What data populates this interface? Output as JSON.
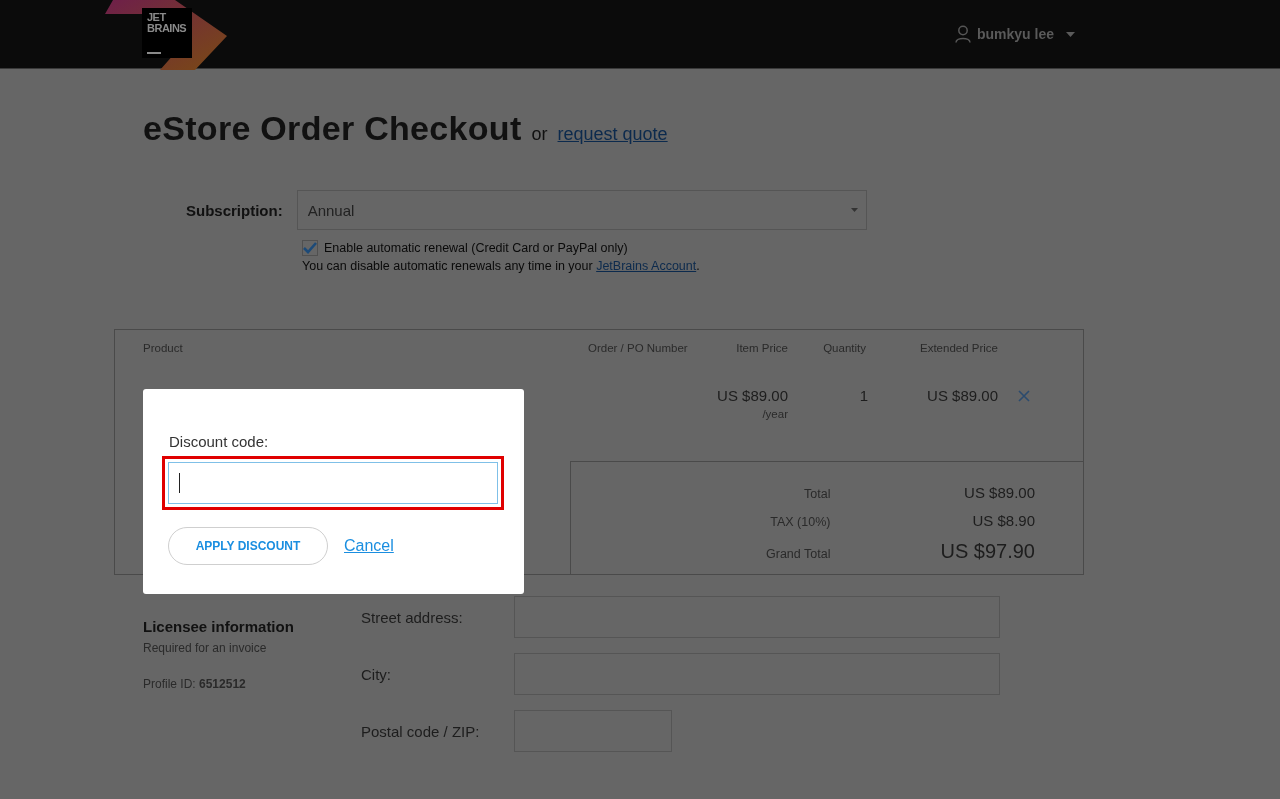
{
  "header": {
    "logo": [
      "JET",
      "BRAINS"
    ],
    "user": "bumkyu lee"
  },
  "title": "eStore Order Checkout",
  "title_or": "or",
  "request_quote": "request quote",
  "subscription": {
    "label": "Subscription:",
    "value": "Annual"
  },
  "renewal": {
    "label": "Enable automatic renewal (Credit Card or PayPal only)",
    "checked": true,
    "note": "You can disable automatic renewals any time in your ",
    "link": "JetBrains Account",
    "note_end": "."
  },
  "table": {
    "columns": [
      "Product",
      "Order / PO Number",
      "Item Price",
      "Quantity",
      "Extended Price"
    ],
    "rows": [
      {
        "item_price": "US $89.00",
        "period": "/year",
        "quantity": "1",
        "extended_price": "US $89.00"
      }
    ],
    "totals": [
      {
        "label": "Total",
        "value": "US $89.00",
        "kind": "normal"
      },
      {
        "label": "TAX (10%)",
        "value": "US $8.90",
        "kind": "normal"
      },
      {
        "label": "Grand Total",
        "value": "US $97.90",
        "kind": "grand"
      }
    ]
  },
  "licensee": {
    "heading": "Licensee information",
    "sub": "Required for an invoice",
    "profile": "Profile ID: **6512512**",
    "fields": [
      {
        "label": "Street address:",
        "kind": "wide"
      },
      {
        "label": "City:",
        "kind": "wide"
      },
      {
        "label": "Postal code / ZIP:",
        "kind": "short"
      }
    ]
  },
  "dialog": {
    "label": "Discount code:",
    "highlighted": true,
    "apply": "APPLY DISCOUNT",
    "cancel": "Cancel"
  }
}
